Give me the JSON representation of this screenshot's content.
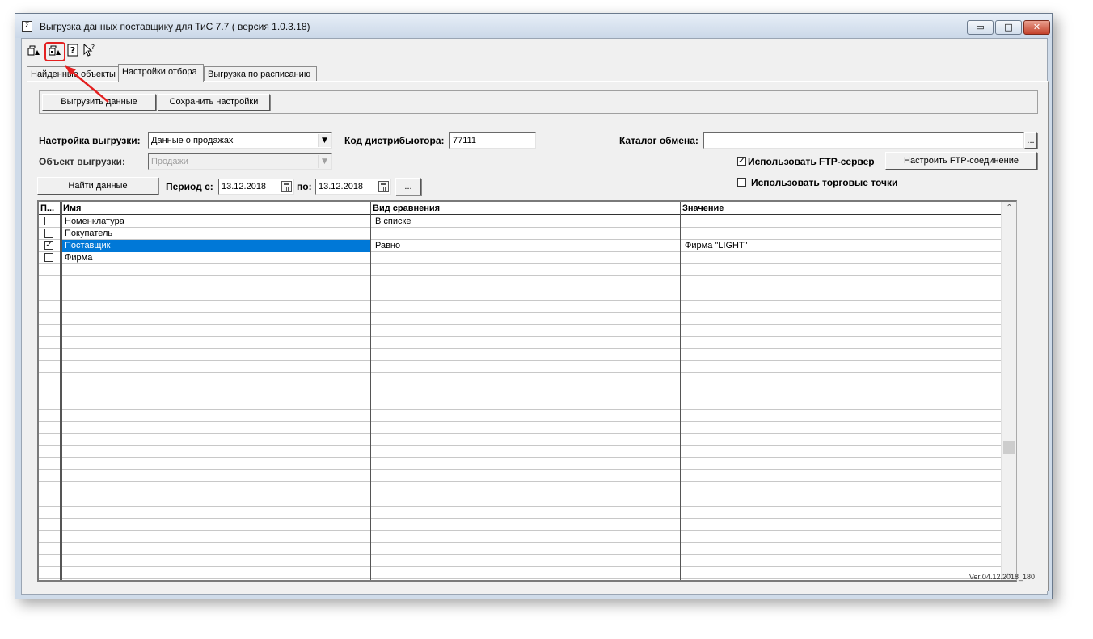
{
  "window": {
    "title": "Выгрузка данных поставщику для ТиС 7.7 ( версия 1.0.3.18)",
    "app_icon": "document-icon"
  },
  "toolbar": {
    "buttons": [
      "open-icon",
      "save-icon",
      "help-icon",
      "whats-this-icon"
    ],
    "highlighted_index": 1,
    "highlight_color": "#e32020"
  },
  "tabs": {
    "items": [
      "Найденные объекты",
      "Настройки отбора",
      "Выгрузка по расписанию"
    ],
    "active_index": 1
  },
  "actions": {
    "export_label": "Выгрузить данные",
    "save_settings_label": "Сохранить настройки"
  },
  "form": {
    "export_setting_label": "Настройка выгрузки:",
    "export_setting_value": "Данные о продажах",
    "export_object_label": "Объект выгрузки:",
    "export_object_value": "Продажи",
    "distributor_code_label": "Код дистрибьютора:",
    "distributor_code_value": "77111",
    "exchange_catalog_label": "Каталог обмена:",
    "exchange_catalog_value": "",
    "use_ftp_label": "Использовать FTP-сервер",
    "use_ftp_checked": true,
    "configure_ftp_label": "Настроить FTP-соединение",
    "use_points_label": "Использовать торговые точки",
    "use_points_checked": false,
    "find_label": "Найти данные",
    "period_from_label": "Период с:",
    "period_from_value": "13.12.2018",
    "period_to_label": "по:",
    "period_to_value": "13.12.2018",
    "more_label": "..."
  },
  "grid": {
    "columns": [
      "П...",
      "Имя",
      "Вид сравнения",
      "Значение"
    ],
    "rows": [
      {
        "checked": false,
        "name": "Номенклатура",
        "comparison": "В списке",
        "value": ""
      },
      {
        "checked": false,
        "name": "Покупатель",
        "comparison": "",
        "value": ""
      },
      {
        "checked": true,
        "name": "Поставщик",
        "comparison": "Равно",
        "value": "Фирма \"LIGHT\"",
        "selected": true
      },
      {
        "checked": false,
        "name": "Фирма",
        "comparison": "",
        "value": ""
      }
    ]
  },
  "footer": {
    "version": "Ver 04.12.2018_180"
  },
  "colors": {
    "selection": "#0078d7",
    "window_frame": "#cfdbe9",
    "annotation": "#e32020"
  }
}
